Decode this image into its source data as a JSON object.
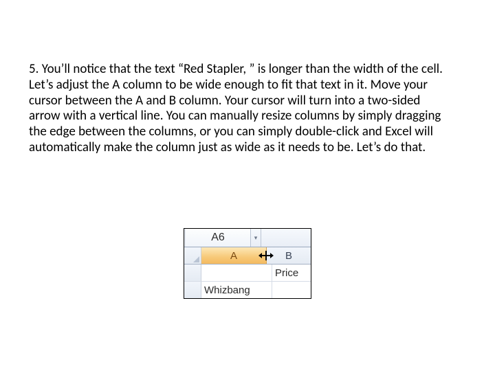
{
  "step_number": "5.",
  "paragraph": "You’ll notice that the text “Red Stapler, ” is longer than the width of the cell. Let’s adjust the A column to be wide enough to fit that text in it. Move your cursor between the A and B column. Your cursor will turn into a two-sided arrow with a vertical line. You can manually resize columns by simply dragging the edge between the columns, or you can simply double-click and Excel will automatically make the column just as wide as it needs to be. Let’s do that.",
  "excel": {
    "namebox": "A6",
    "columns": {
      "A": "A",
      "B": "B"
    },
    "rows": [
      {
        "A": "",
        "B": "Price"
      },
      {
        "A": "Whizbang",
        "B": ""
      }
    ]
  }
}
